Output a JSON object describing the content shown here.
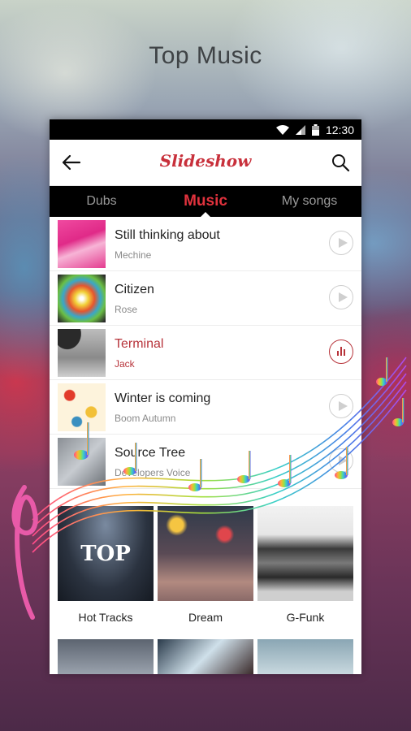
{
  "page_title": "Top Music",
  "status_bar": {
    "time": "12:30",
    "icons": [
      "wifi-icon",
      "signal-icon",
      "battery-icon"
    ]
  },
  "app_bar": {
    "title": "Slideshow",
    "back_icon": "arrow-left-icon",
    "search_icon": "search-icon"
  },
  "tabs": [
    {
      "label": "Dubs"
    },
    {
      "label": "Music",
      "active": true
    },
    {
      "label": "My songs"
    }
  ],
  "tracks": [
    {
      "title": "Still thinking about",
      "artist": "Mechine",
      "state": "play"
    },
    {
      "title": "Citizen",
      "artist": "Rose",
      "state": "play"
    },
    {
      "title": "Terminal",
      "artist": "Jack",
      "state": "playing"
    },
    {
      "title": "Winter is coming",
      "artist": "Boom Autumn",
      "state": "play"
    },
    {
      "title": "Source Tree",
      "artist": "Developers Voice",
      "state": "play"
    }
  ],
  "playlists": [
    {
      "label": "Hot Tracks",
      "overlay_text": "TOP"
    },
    {
      "label": "Dream"
    },
    {
      "label": "G-Funk"
    }
  ],
  "colors": {
    "accent": "#e0323d",
    "playing": "#b7333a",
    "tab_bg": "#000000"
  }
}
